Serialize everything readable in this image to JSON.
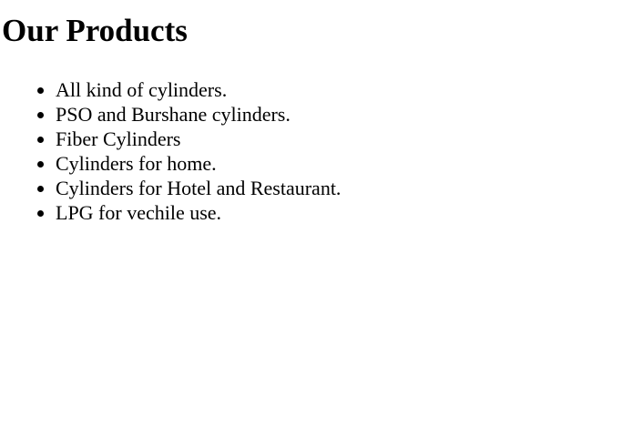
{
  "page": {
    "title": "Our Products"
  },
  "products": [
    {
      "label": "All kind of cylinders."
    },
    {
      "label": "PSO and Burshane cylinders."
    },
    {
      "label": "Fiber Cylinders"
    },
    {
      "label": "Cylinders for home."
    },
    {
      "label": "Cylinders for Hotel and Restaurant."
    },
    {
      "label": "LPG for vechile use."
    }
  ],
  "colors": {
    "background": "#ffffff",
    "text": "#000000"
  }
}
